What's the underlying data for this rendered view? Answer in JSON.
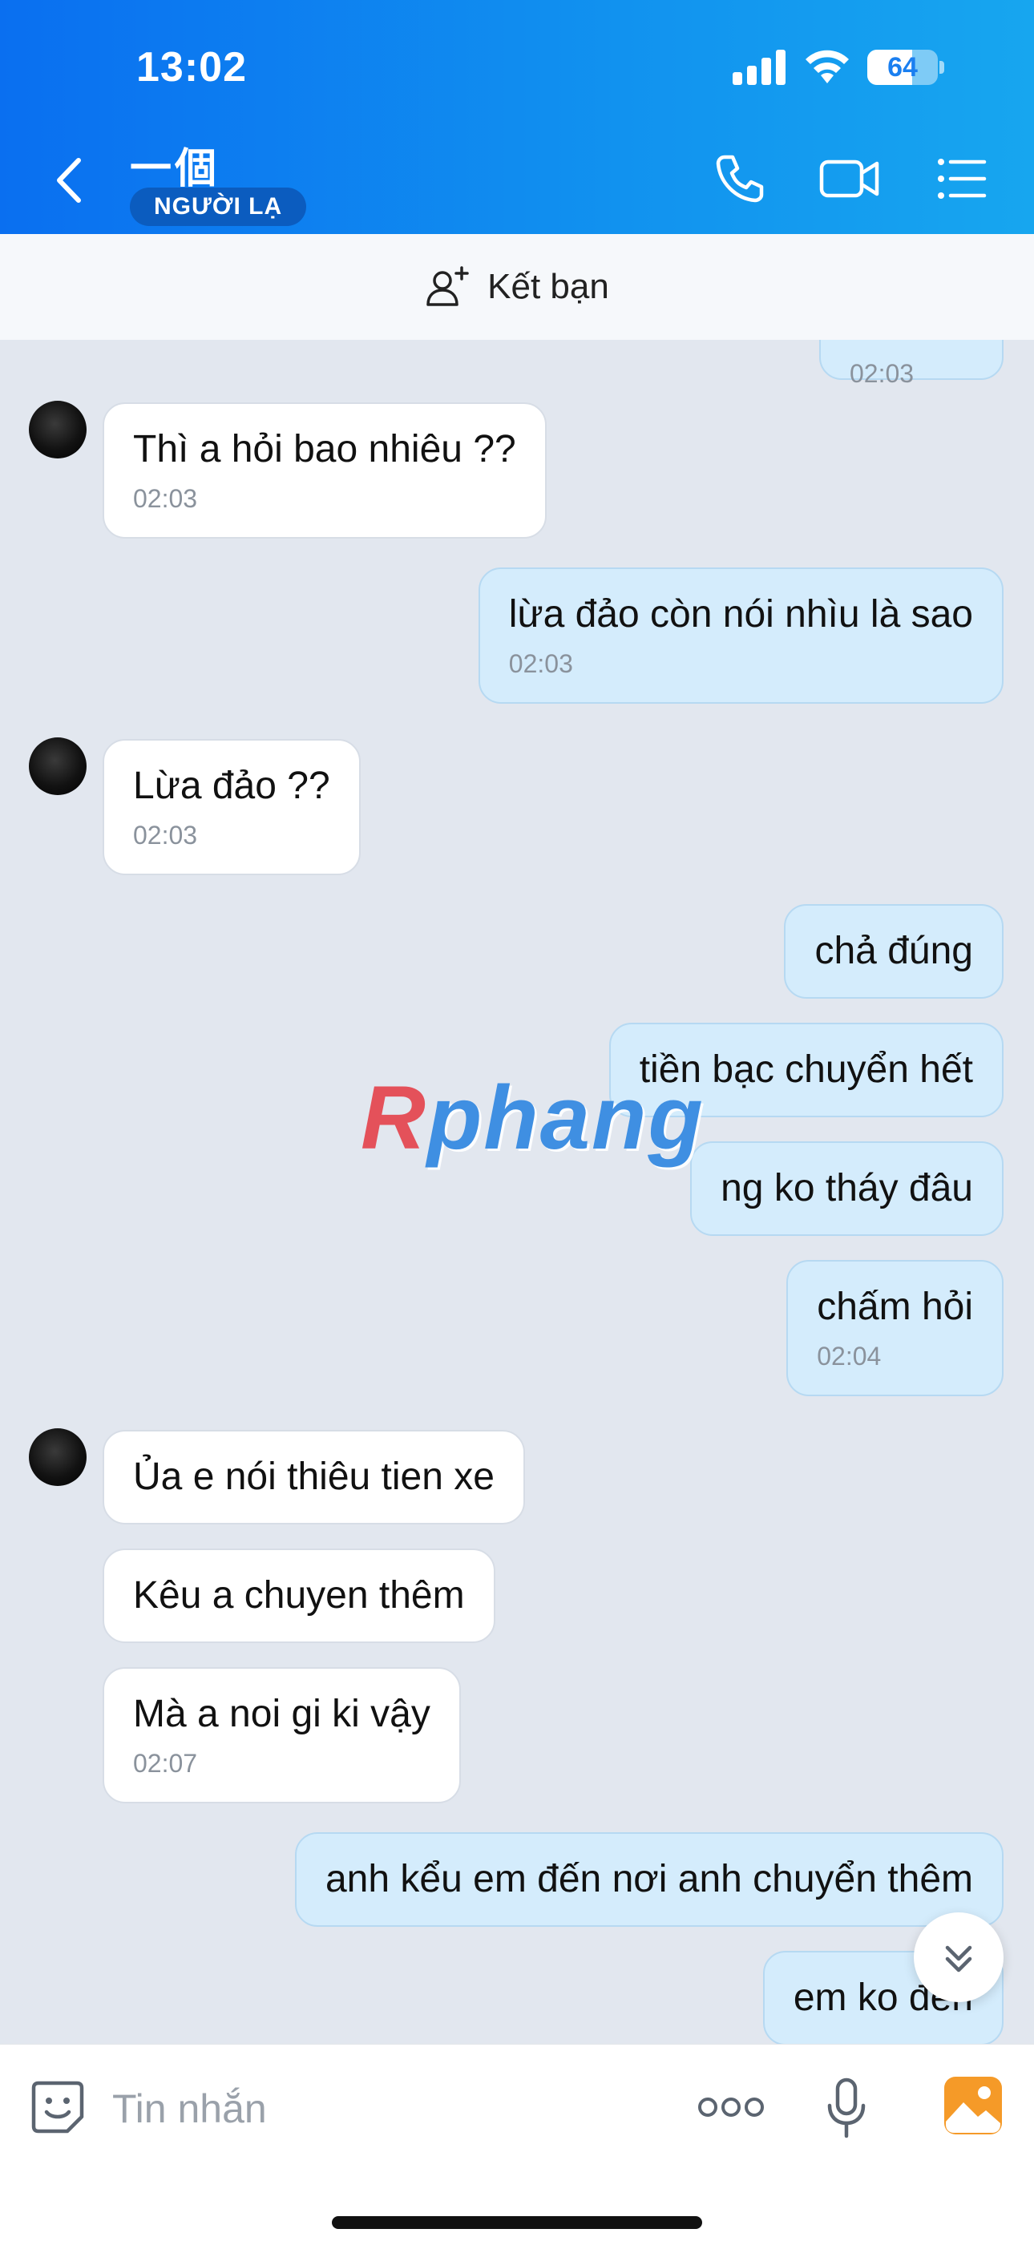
{
  "status_bar": {
    "time": "13:02",
    "battery_level": 64,
    "battery_text": "64"
  },
  "header": {
    "contact_name": "一個",
    "badge": "NGƯỜI LẠ",
    "icons": [
      "back-icon",
      "phone-icon",
      "video-call-icon",
      "menu-list-icon"
    ]
  },
  "add_friend": {
    "label": "Kết bạn",
    "icon": "add-friend-icon"
  },
  "messages": [
    {
      "side": "out",
      "text": "",
      "time": "02:03",
      "partial": true
    },
    {
      "side": "in",
      "text": "Thì a hỏi bao nhiêu ??",
      "time": "02:03"
    },
    {
      "side": "out",
      "text": "lừa đảo còn nói nhìu là sao",
      "time": "02:03"
    },
    {
      "side": "in",
      "text": "Lừa đảo ??",
      "time": "02:03"
    },
    {
      "side": "out",
      "text": "chả đúng",
      "time": ""
    },
    {
      "side": "out",
      "text": "tiền bạc chuyển hết",
      "time": ""
    },
    {
      "side": "out",
      "text": "ng ko tháy đâu",
      "time": ""
    },
    {
      "side": "out",
      "text": "chấm hỏi",
      "time": "02:04"
    },
    {
      "side": "in",
      "text": "Ủa e nói thiêu tien xe",
      "time": ""
    },
    {
      "side": "in",
      "text": "Kêu a chuyen thêm",
      "time": ""
    },
    {
      "side": "in",
      "text": "Mà a noi gi ki vậy",
      "time": "02:07"
    },
    {
      "side": "out",
      "text": "anh kểu em đến nơi anh chuyển thêm",
      "time": ""
    },
    {
      "side": "out",
      "text": "em ko đến",
      "time": ""
    }
  ],
  "watermark": {
    "first": "R",
    "rest": "phang"
  },
  "input_bar": {
    "placeholder": "Tin nhắn",
    "icons": [
      "sticker-icon",
      "more-options-icon",
      "microphone-icon",
      "photo-gallery-icon"
    ]
  },
  "colors": {
    "header_start": "#0a6ff0",
    "header_end": "#17a6ef",
    "outgoing_bubble": "#d4ecfc",
    "chat_bg": "#e2e7ef"
  }
}
